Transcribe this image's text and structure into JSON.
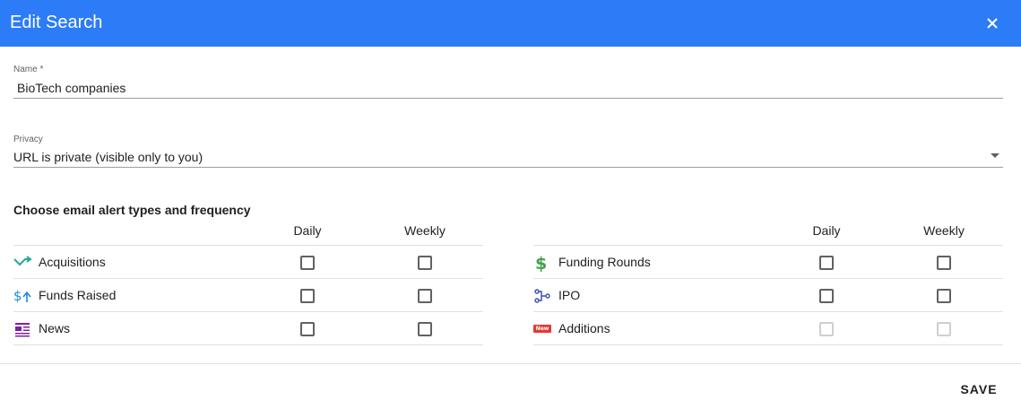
{
  "dialog": {
    "title": "Edit Search",
    "close_icon": "close-icon"
  },
  "name_field": {
    "label": "Name *",
    "value": "BioTech companies"
  },
  "privacy_field": {
    "label": "Privacy",
    "value": "URL is private (visible only to you)",
    "icon": "dropdown-arrow-icon"
  },
  "alerts": {
    "title": "Choose email alert types and frequency",
    "daily_label": "Daily",
    "weekly_label": "Weekly",
    "left_rows": [
      {
        "label": "Acquisitions",
        "icon": "acquisitions-icon",
        "daily": false,
        "weekly": false,
        "disabled": false
      },
      {
        "label": "Funds Raised",
        "icon": "funds-raised-icon",
        "daily": false,
        "weekly": false,
        "disabled": false
      },
      {
        "label": "News",
        "icon": "news-icon",
        "daily": false,
        "weekly": false,
        "disabled": false
      }
    ],
    "right_rows": [
      {
        "label": "Funding Rounds",
        "icon": "dollar-icon",
        "daily": false,
        "weekly": false,
        "disabled": false
      },
      {
        "label": "IPO",
        "icon": "ipo-icon",
        "daily": false,
        "weekly": false,
        "disabled": false
      },
      {
        "label": "Additions",
        "icon": "new-badge-icon",
        "badge": "New",
        "daily": false,
        "weekly": false,
        "disabled": true
      }
    ]
  },
  "footer": {
    "save_label": "SAVE"
  },
  "colors": {
    "header": "#2b7cf6",
    "acquisitions": "#26a69a",
    "funds_raised": "#1e88e5",
    "news": "#7b1fa2",
    "funding_rounds": "#43a047",
    "ipo": "#3949ab",
    "new_badge": "#e53935"
  }
}
